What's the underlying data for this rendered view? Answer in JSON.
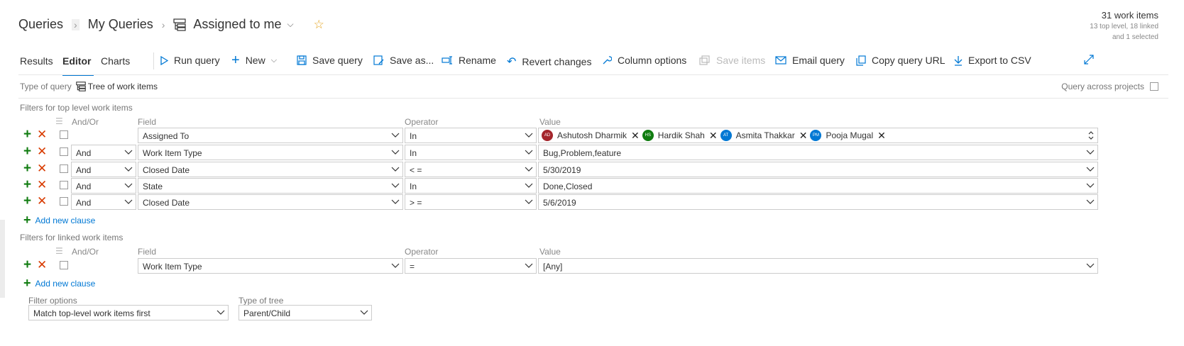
{
  "breadcrumb": {
    "root": "Queries",
    "folder": "My Queries",
    "query": "Assigned to me"
  },
  "summary": {
    "count": "31 work items",
    "detail_line1": "13 top level, 18 linked",
    "detail_line2": "and 1 selected"
  },
  "tabs": [
    {
      "label": "Results"
    },
    {
      "label": "Editor"
    },
    {
      "label": "Charts"
    }
  ],
  "toolbar": {
    "run": "Run query",
    "new": "New",
    "save": "Save query",
    "save_as": "Save as...",
    "rename": "Rename",
    "revert": "Revert changes",
    "column_options": "Column options",
    "save_items": "Save items",
    "email": "Email query",
    "copy_url": "Copy query URL",
    "export": "Export to CSV"
  },
  "query_type": {
    "label": "Type of query",
    "value": "Tree of work items",
    "across_projects": "Query across projects"
  },
  "top_filters": {
    "title": "Filters for top level work items",
    "headers": {
      "andor": "And/Or",
      "field": "Field",
      "operator": "Operator",
      "value": "Value"
    },
    "rows": [
      {
        "andor": "",
        "field": "Assigned To",
        "operator": "In",
        "value": ""
      },
      {
        "andor": "And",
        "field": "Work Item Type",
        "operator": "In",
        "value": "Bug,Problem,feature"
      },
      {
        "andor": "And",
        "field": "Closed Date",
        "operator": "< =",
        "value": "5/30/2019"
      },
      {
        "andor": "And",
        "field": "State",
        "operator": "In",
        "value": "Done,Closed"
      },
      {
        "andor": "And",
        "field": "Closed Date",
        "operator": "> =",
        "value": "5/6/2019"
      }
    ],
    "assignees": [
      {
        "initials": "AD",
        "name": "Ashutosh Dharmik",
        "color": "#a4262c"
      },
      {
        "initials": "HS",
        "name": "Hardik Shah",
        "color": "#107c10"
      },
      {
        "initials": "AT",
        "name": "Asmita Thakkar",
        "color": "#0078d4"
      },
      {
        "initials": "PM",
        "name": "Pooja Mugal",
        "color": "#0078d4"
      }
    ],
    "add_clause": "Add new clause"
  },
  "linked_filters": {
    "title": "Filters for linked work items",
    "headers": {
      "andor": "And/Or",
      "field": "Field",
      "operator": "Operator",
      "value": "Value"
    },
    "rows": [
      {
        "andor": "",
        "field": "Work Item Type",
        "operator": "=",
        "value": "[Any]"
      }
    ],
    "add_clause": "Add new clause"
  },
  "filter_options": {
    "label": "Filter options",
    "value": "Match top-level work items first"
  },
  "tree_type": {
    "label": "Type of tree",
    "value": "Parent/Child"
  }
}
